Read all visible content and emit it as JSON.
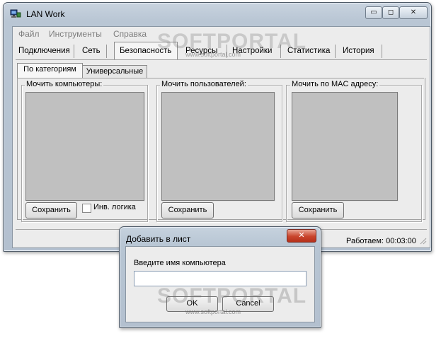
{
  "main_window": {
    "title": "LAN Work",
    "controls": {
      "minimize": "▭",
      "maximize": "◻",
      "close": "✕"
    }
  },
  "menu": {
    "items": [
      "Файл",
      "Инструменты",
      "Справка"
    ]
  },
  "top_tabs": {
    "items": [
      "Подключения",
      "Сеть",
      "Безопасность",
      "Ресурсы",
      "Настройки",
      "Статистика",
      "История"
    ],
    "selected": "Безопасность"
  },
  "inner_tabs": {
    "items": [
      "По категориям",
      "Универсальные"
    ],
    "selected": "По категориям"
  },
  "groups": [
    {
      "label": "Мочить компьютеры:",
      "save_button": "Сохранить"
    },
    {
      "label": "Мочить пользователей:",
      "save_button": "Сохранить"
    },
    {
      "label": "Мочить по MAC адресу:",
      "save_button": "Сохранить"
    }
  ],
  "invert_logic": {
    "label": "Инв. логика",
    "checked": false
  },
  "status": {
    "uptime": "Работаем: 00:03:00"
  },
  "dialog": {
    "title": "Добавить в лист",
    "prompt": "Введите имя компьютера",
    "input_value": "",
    "ok_label": "OK",
    "cancel_label": "Cancel",
    "close_glyph": "✕"
  },
  "watermark": {
    "brand": "SOFTPORTAL",
    "url": "www.softportal.com"
  }
}
